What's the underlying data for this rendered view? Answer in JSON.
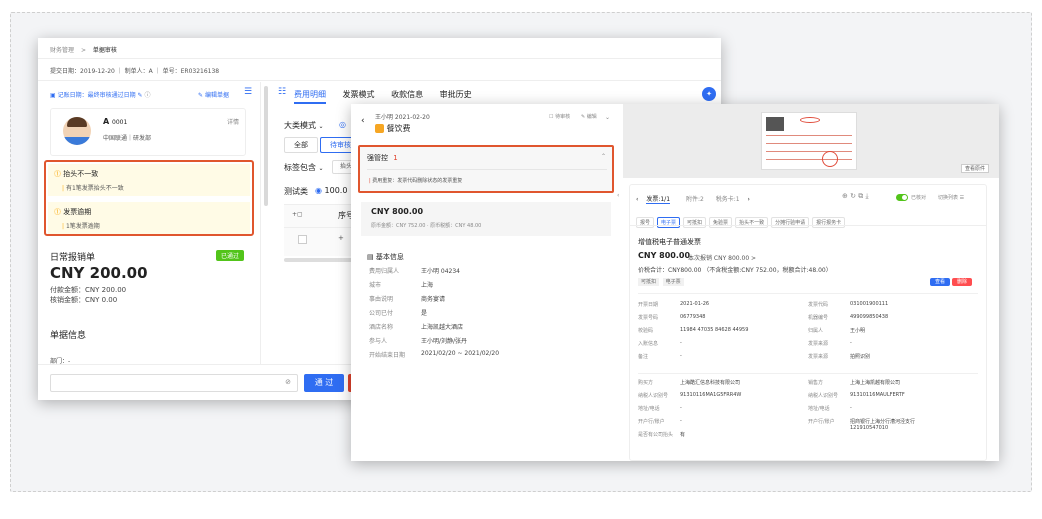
{
  "winA": {
    "breadcrumb": {
      "root": "财务管理",
      "sep": ">",
      "current": "单据审核"
    },
    "meta": "提交日期：2019-12-20 ｜ 制单人：A ｜ 单号：ER03216138",
    "left": {
      "record_date": "记账日期：最终审核通过日期",
      "edit_doc": "编辑单据",
      "user": {
        "name": "A",
        "id": "0001",
        "dept": "中国联通｜研发部",
        "detail": "详情"
      },
      "alerts": [
        {
          "title": "抬头不一致",
          "desc": "有1笔发票抬头不一致"
        },
        {
          "title": "发票逾期",
          "desc": "1笔发票逾期"
        }
      ],
      "report": {
        "title": "日常报销单",
        "status": "已通过",
        "amount": "CNY 200.00",
        "paid": "付款金额：CNY 200.00",
        "written_off": "核销金额：CNY 0.00"
      },
      "doc_info_title": "单据信息",
      "dept_label": "部门：-"
    },
    "tabs": [
      "费用明细",
      "发票模式",
      "收款信息",
      "审批历史"
    ],
    "detail": {
      "mode": "大类模式",
      "filters": [
        "全部",
        "待审核"
      ],
      "tag_contains": "标签包含",
      "tag_value": "抬头",
      "test_label": "测试类",
      "test_value": "100.0",
      "col_seq": "序号"
    },
    "footer": {
      "approve": "通 过"
    },
    "colors": {
      "accent": "#2f6df2",
      "alert_border": "#e0562e",
      "alert_bg": "#fffbe6",
      "success": "#52c41a"
    }
  },
  "winB": {
    "header": {
      "title_line": "王小明 2021-02-20",
      "expense_type": "餐饮费",
      "pending": "待审核",
      "edit": "编辑"
    },
    "strong_control": {
      "label": "强管控",
      "count": "1",
      "message": "费用重复：发票代码删除状态的发票重复"
    },
    "amount_card": {
      "amount": "CNY 800.00",
      "sub": "原币金额：CNY 752.00 · 原币税额：CNY 48.00"
    },
    "basic_info": {
      "title": "基本信息",
      "rows": [
        {
          "k": "费用归属人",
          "v": "王小明 04234"
        },
        {
          "k": "城市",
          "v": "上海"
        },
        {
          "k": "事由说明",
          "v": "商务宴请"
        },
        {
          "k": "公司已付",
          "v": "是"
        },
        {
          "k": "酒店名称",
          "v": "上海凯越大酒店"
        },
        {
          "k": "参与人",
          "v": "王小明/刘静/张丹"
        },
        {
          "k": "开始结束日期",
          "v": "2021/02/20 ~ 2021/02/20"
        }
      ]
    },
    "preview": {
      "view_original": "查看原件"
    },
    "invoice_nav": {
      "label": "发票:1/1",
      "attachments": "附件:2",
      "other": "税务卡:1",
      "ocr": "已核对",
      "switch_mode": "切换列表"
    },
    "invoice_tags": [
      "报号",
      "电子票",
      "可抵扣",
      "免验票",
      "抬头不一致",
      "分摊行验申请",
      "报行报务卡"
    ],
    "invoice": {
      "title": "增值税电子普通发票",
      "amount": "CNY 800.00",
      "amount_note": "本次报销 CNY 800.00 >",
      "total_line": "价税合计：CNY800.00 （不含税金额:CNY 752.00，税额合计:48.00）",
      "chips": [
        "可抵扣",
        "电子票"
      ],
      "btn_a": "查看",
      "btn_b": "删除",
      "fields_left": [
        {
          "k": "开票日期",
          "v": "2021-01-26"
        },
        {
          "k": "发票号码",
          "v": "06779348"
        },
        {
          "k": "校验码",
          "v": "11984 47035 84628 44959"
        },
        {
          "k": "入账信息",
          "v": "-"
        },
        {
          "k": "备注",
          "v": "-"
        }
      ],
      "fields_right": [
        {
          "k": "发票代码",
          "v": "031001900111"
        },
        {
          "k": "机器编号",
          "v": "499099850438"
        },
        {
          "k": "归属人",
          "v": "王小明"
        },
        {
          "k": "发票来源",
          "v": "-"
        },
        {
          "k": "发票来源",
          "v": "拍照识别"
        }
      ],
      "buyer": [
        {
          "k": "购买方",
          "v": "上海酷汇信息科技有限公司"
        },
        {
          "k": "纳税人识别号",
          "v": "91310116MA1G5FRR4W"
        },
        {
          "k": "地址/电话",
          "v": "-"
        },
        {
          "k": "开户行/账户",
          "v": "-"
        },
        {
          "k": "是否有公司抬头",
          "v": "有"
        }
      ],
      "seller": [
        {
          "k": "销售方",
          "v": "上海上海凯越有限公司"
        },
        {
          "k": "纳税人识别号",
          "v": "91310116MAULFERTF"
        },
        {
          "k": "地址/电话",
          "v": "-"
        },
        {
          "k": "开户行/账户",
          "v": "招商银行上海分行漕河泾支行 121910547010"
        }
      ]
    }
  }
}
